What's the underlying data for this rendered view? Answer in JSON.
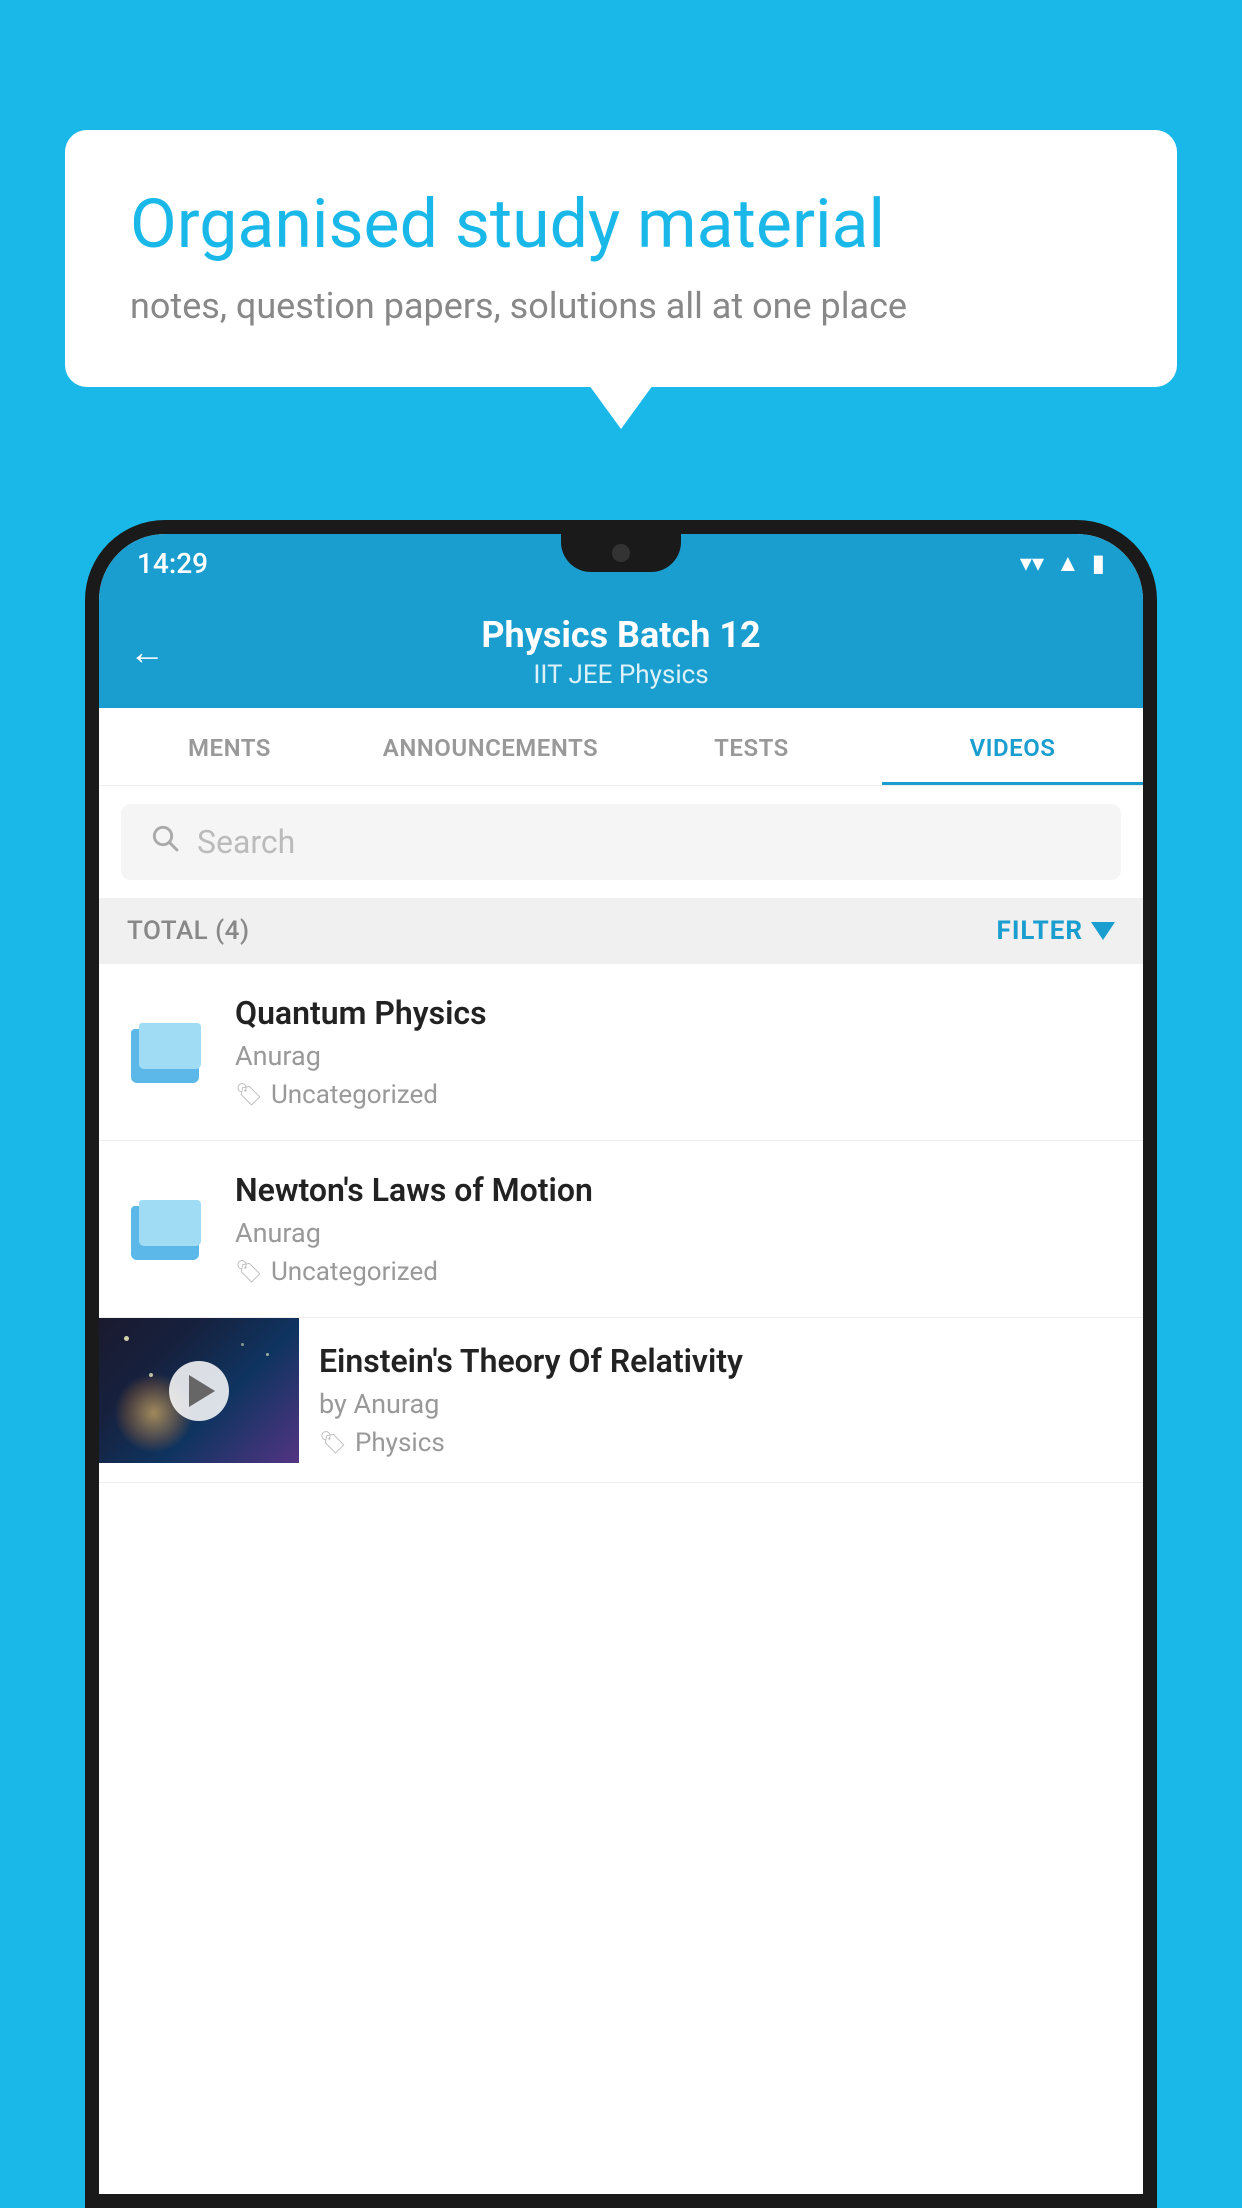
{
  "background_color": "#1ab8e8",
  "speech_bubble": {
    "heading": "Organised study material",
    "subtext": "notes, question papers, solutions all at one place"
  },
  "phone": {
    "status_bar": {
      "time": "14:29",
      "icons": [
        "wifi",
        "signal",
        "battery"
      ]
    },
    "header": {
      "back_label": "←",
      "title": "Physics Batch 12",
      "subtitle": "IIT JEE    Physics"
    },
    "tabs": [
      {
        "label": "MENTS",
        "active": false
      },
      {
        "label": "ANNOUNCEMENTS",
        "active": false
      },
      {
        "label": "TESTS",
        "active": false
      },
      {
        "label": "VIDEOS",
        "active": true
      }
    ],
    "search": {
      "placeholder": "Search"
    },
    "filter_bar": {
      "total_label": "TOTAL (4)",
      "filter_label": "FILTER"
    },
    "videos": [
      {
        "title": "Quantum Physics",
        "author": "Anurag",
        "tag": "Uncategorized",
        "has_thumb": false
      },
      {
        "title": "Newton's Laws of Motion",
        "author": "Anurag",
        "tag": "Uncategorized",
        "has_thumb": false
      },
      {
        "title": "Einstein's Theory Of Relativity",
        "author": "by Anurag",
        "tag": "Physics",
        "has_thumb": true
      }
    ]
  }
}
